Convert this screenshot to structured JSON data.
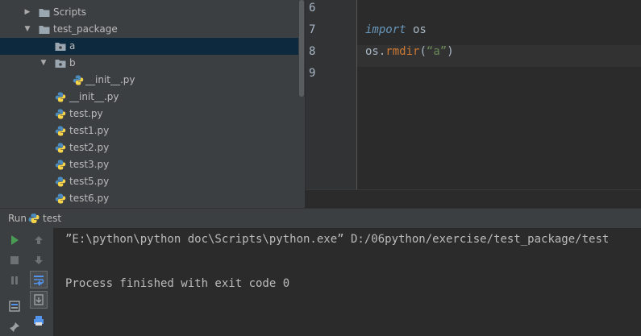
{
  "project_tree": {
    "items": [
      {
        "label": "Scripts",
        "kind": "folder",
        "arrow": "right"
      },
      {
        "label": "test_package",
        "kind": "folder",
        "arrow": "down"
      },
      {
        "label": "a",
        "kind": "package",
        "arrow": ""
      },
      {
        "label": "b",
        "kind": "package",
        "arrow": "down"
      },
      {
        "label": "__init__.py",
        "kind": "python",
        "arrow": ""
      },
      {
        "label": "__init__.py",
        "kind": "python",
        "arrow": ""
      },
      {
        "label": "test.py",
        "kind": "python",
        "arrow": ""
      },
      {
        "label": "test1.py",
        "kind": "python",
        "arrow": ""
      },
      {
        "label": "test2.py",
        "kind": "python",
        "arrow": ""
      },
      {
        "label": "test3.py",
        "kind": "python",
        "arrow": ""
      },
      {
        "label": "test5.py",
        "kind": "python",
        "arrow": ""
      },
      {
        "label": "test6.py",
        "kind": "python",
        "arrow": ""
      }
    ],
    "selected_label": "a"
  },
  "editor": {
    "lines": [
      {
        "number": "6",
        "tokens": []
      },
      {
        "number": "7",
        "tokens": [
          {
            "text": "import",
            "style": "kw"
          },
          {
            "text": " os",
            "style": "plain"
          }
        ]
      },
      {
        "number": "8",
        "tokens": [
          {
            "text": "os.",
            "style": "plain"
          },
          {
            "text": "rmdir",
            "style": "fn"
          },
          {
            "text": "(",
            "style": "plain"
          },
          {
            "text": "“a”",
            "style": "str"
          },
          {
            "text": ")",
            "style": "plain"
          }
        ]
      },
      {
        "number": "9",
        "tokens": []
      }
    ],
    "current_line": "8"
  },
  "run_panel": {
    "tab_label": "Run",
    "config_name": "test",
    "console_lines": [
      "”E:\\python\\python doc\\Scripts\\python.exe” D:/06python/exercise/test_package/test",
      "",
      "Process finished with exit code 0"
    ],
    "tools": [
      {
        "icon": "rerun-icon",
        "color": "#499c54"
      },
      {
        "icon": "up-arrow-icon",
        "color": "#6e7174"
      },
      {
        "icon": "stop-icon",
        "color": "#6e7174"
      },
      {
        "icon": "down-arrow-icon",
        "color": "#6e7174"
      },
      {
        "icon": "pause-icon",
        "color": "#6e7174"
      },
      {
        "icon": "soft-wrap-icon",
        "color": "#5394ec"
      },
      {
        "icon": "layout-icon",
        "color": "#9da0a3"
      },
      {
        "icon": "scroll-to-end-icon",
        "color": "#9da0a3"
      },
      {
        "icon": "pin-icon",
        "color": "#9da0a3"
      },
      {
        "icon": "print-icon",
        "color": "#5394ec"
      }
    ]
  },
  "colors": {
    "panel_bg": "#3c3f41",
    "editor_bg": "#2b2b2b",
    "selection": "#0d293e",
    "current_line": "#323232",
    "keyword": "#6897bb",
    "function": "#cc7832",
    "string": "#6a8759"
  }
}
